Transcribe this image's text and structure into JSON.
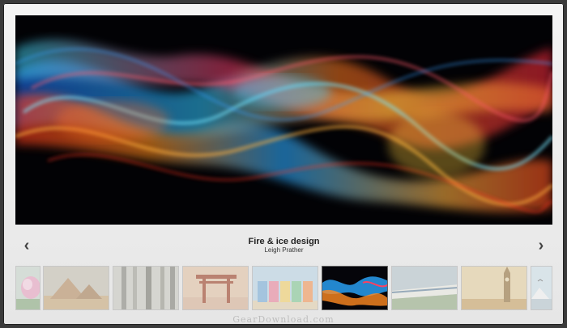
{
  "slide": {
    "title": "Fire & ice design",
    "author": "Leigh Prather"
  },
  "nav": {
    "prev_icon": "chevron-left-icon",
    "next_icon": "chevron-right-icon",
    "prev_glyph": "‹",
    "next_glyph": "›"
  },
  "watermark": "GearDownload.com",
  "thumbnails": [
    {
      "subject": "flower",
      "active": false
    },
    {
      "subject": "pyramids",
      "active": false
    },
    {
      "subject": "bamboo",
      "active": false
    },
    {
      "subject": "torii-gate",
      "active": false
    },
    {
      "subject": "beach-huts",
      "active": false
    },
    {
      "subject": "fire-and-ice",
      "active": true
    },
    {
      "subject": "train",
      "active": false
    },
    {
      "subject": "big-ben",
      "active": false
    },
    {
      "subject": "birds-sky",
      "active": false
    },
    {
      "subject": "mountains",
      "active": false
    }
  ]
}
